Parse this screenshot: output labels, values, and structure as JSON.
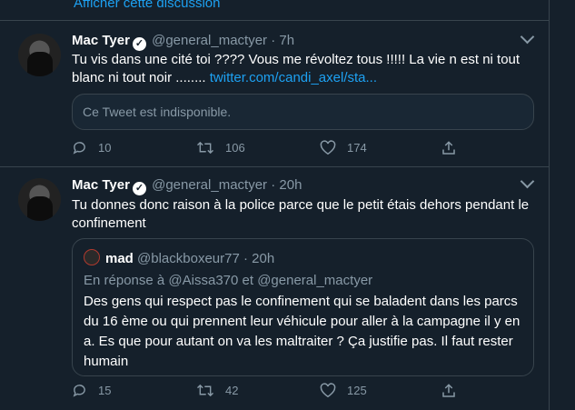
{
  "show_thread": "Afficher cette discussion",
  "tweets": [
    {
      "name": "Mac Tyer",
      "handle": "@general_mactyer",
      "time": "7h",
      "text": "Tu vis dans une cité toi ???? Vous me révoltez tous !!!!! La vie n est ni tout blanc ni tout noir ........ ",
      "link": "twitter.com/candi_axel/sta...",
      "unavailable": "Ce Tweet est indisponible.",
      "replies": "10",
      "retweets": "106",
      "likes": "174"
    },
    {
      "name": "Mac Tyer",
      "handle": "@general_mactyer",
      "time": "20h",
      "text": "Tu donnes donc raison à la police parce que le petit étais dehors pendant le confinement",
      "quote": {
        "name": "mad",
        "handle": "@blackboxeur77",
        "time": "20h",
        "reply_prefix": "En réponse à",
        "mention1": "@Aissa370",
        "and": "et",
        "mention2": "@general_mactyer",
        "text": "Des gens qui respect pas le confinement qui se baladent dans les parcs du 16 ème ou qui prennent leur véhicule pour aller à la campagne il y en a. Es que pour autant on va les maltraiter ? Ça justifie pas. Il faut rester humain"
      },
      "replies": "15",
      "retweets": "42",
      "likes": "125"
    }
  ],
  "colors": {
    "background": "#15202b",
    "accent": "#1da1f2",
    "muted": "#8899a6",
    "border": "#38444d"
  }
}
